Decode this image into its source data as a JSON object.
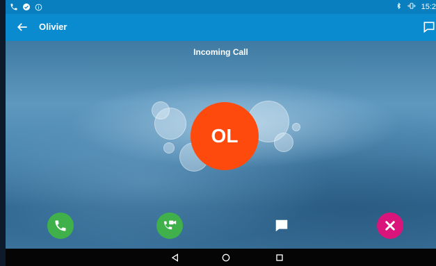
{
  "status_bar": {
    "time": "15:2",
    "icons": [
      "phone-icon",
      "check-circle-icon",
      "info-icon",
      "bluetooth-icon",
      "vibrate-icon"
    ]
  },
  "app_bar": {
    "back_icon": "arrow-left-icon",
    "contact_name": "Olivier",
    "chat_icon": "chat-bubble-icon"
  },
  "call": {
    "status_text": "Incoming Call",
    "initials": "OL",
    "avatar_color": "#ff4a0e"
  },
  "actions": [
    {
      "name": "answer-call-button",
      "icon": "phone-icon",
      "color": "#3fb04a"
    },
    {
      "name": "answer-video-button",
      "icon": "video-call-icon",
      "color": "#3fb04a"
    },
    {
      "name": "reply-message-button",
      "icon": "message-icon",
      "color": "transparent"
    },
    {
      "name": "decline-call-button",
      "icon": "close-icon",
      "color": "#d9147a"
    }
  ],
  "nav_bar": {
    "icons": [
      "nav-back-icon",
      "nav-home-icon",
      "nav-recents-icon"
    ]
  },
  "colors": {
    "primary": "#0a8bd0",
    "status_bar": "#0a7fbf",
    "accept": "#3fb04a",
    "decline": "#d9147a"
  }
}
